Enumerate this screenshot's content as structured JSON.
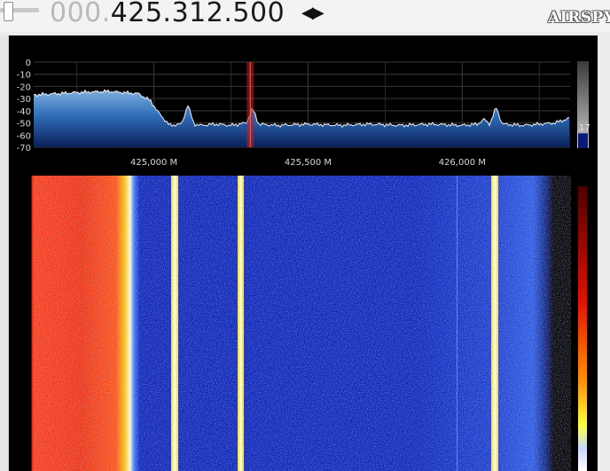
{
  "toolbar": {
    "frequency_lead": "000.",
    "frequency_main": "425.312.500",
    "step_arrows": "◀▶",
    "logo_text": "AIRSPY"
  },
  "spectrum": {
    "y_ticks": [
      "0",
      "-10",
      "-20",
      "-30",
      "-40",
      "-50",
      "-60",
      "-70"
    ],
    "x_ticks": [
      "425,000 M",
      "425,500 M",
      "426,000 M"
    ],
    "level_value": "17",
    "level_fraction": 0.17
  },
  "waterfall": {
    "colormap": [
      "#00001e",
      "#0000a0",
      "#1e4cff",
      "#ffffff",
      "#ffff00",
      "#ff9000",
      "#e01000",
      "#600000"
    ]
  },
  "chart_data": {
    "type": "area",
    "y_ticks": [
      0,
      -10,
      -20,
      -30,
      -40,
      -50,
      -60,
      -70
    ],
    "ylim": [
      -70,
      0
    ],
    "x_tick_labels": [
      "425,000 M",
      "425,500 M",
      "426,000 M"
    ],
    "xlim_mhz": [
      424.61,
      426.35
    ],
    "x_mhz": [
      424.61,
      424.75,
      424.85,
      424.95,
      424.99,
      425.01,
      425.05,
      425.09,
      425.11,
      425.13,
      425.15,
      425.2,
      425.25,
      425.3,
      425.32,
      425.34,
      425.4,
      425.5,
      425.6,
      425.7,
      425.8,
      425.9,
      426.0,
      426.05,
      426.07,
      426.09,
      426.11,
      426.13,
      426.2,
      426.3,
      426.35
    ],
    "y_db": [
      -27,
      -25,
      -24,
      -26,
      -32,
      -40,
      -52,
      -51,
      -35,
      -51,
      -52,
      -51,
      -52,
      -50,
      -38,
      -51,
      -52,
      -51,
      -52,
      -51,
      -52,
      -51,
      -52,
      -51,
      -47,
      -51,
      -37,
      -51,
      -52,
      -50,
      -46
    ],
    "grid": true,
    "tuned_marker_mhz": 425.3125
  }
}
